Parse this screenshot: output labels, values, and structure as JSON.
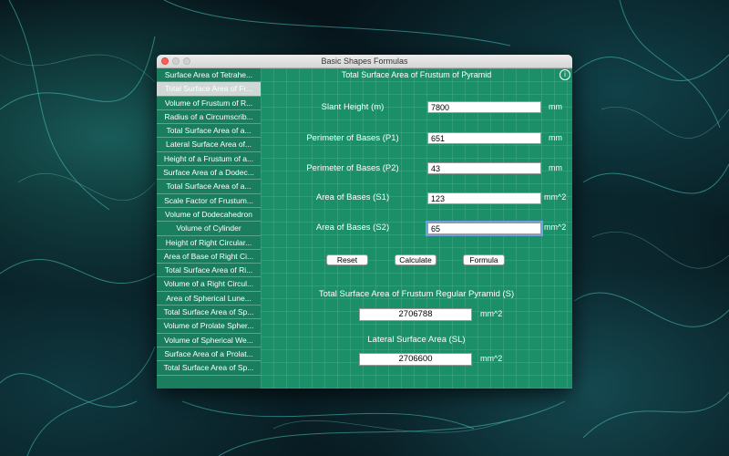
{
  "window": {
    "title": "Basic Shapes Formulas"
  },
  "sidebar": {
    "items": [
      {
        "label": "Surface Area of Tetrahe..."
      },
      {
        "label": "Total Surface Area of Fr..."
      },
      {
        "label": "Volume of Frustum of R..."
      },
      {
        "label": "Radius of a Circumscrib..."
      },
      {
        "label": "Total Surface Area of a..."
      },
      {
        "label": "Lateral Surface Area of..."
      },
      {
        "label": "Height of a Frustum of a..."
      },
      {
        "label": "Surface Area of a Dodec..."
      },
      {
        "label": "Total Surface Area of a..."
      },
      {
        "label": "Scale Factor of Frustum..."
      },
      {
        "label": "Volume of Dodecahedron"
      },
      {
        "label": "Volume of Cylinder"
      },
      {
        "label": "Height of Right Circular..."
      },
      {
        "label": "Area of Base of Right Ci..."
      },
      {
        "label": "Total Surface Area of Ri..."
      },
      {
        "label": "Volume of a Right Circul..."
      },
      {
        "label": "Area of Spherical Lune..."
      },
      {
        "label": "Total Surface Area of Sp..."
      },
      {
        "label": "Volume of Prolate Spher..."
      },
      {
        "label": "Volume of Spherical We..."
      },
      {
        "label": "Surface Area of a Prolat..."
      },
      {
        "label": "Total Surface Area of Sp..."
      }
    ]
  },
  "main": {
    "title": "Total Surface Area of Frustum of Pyramid",
    "fields": [
      {
        "label": "Slant Height (m)",
        "value": "7800",
        "unit": "mm"
      },
      {
        "label": "Perimeter of Bases (P1)",
        "value": "651",
        "unit": "mm"
      },
      {
        "label": "Perimeter of Bases (P2)",
        "value": "43",
        "unit": "mm"
      },
      {
        "label": "Area of Bases (S1)",
        "value": "123",
        "unit": "mm^2"
      },
      {
        "label": "Area of Bases (S2)",
        "value": "65",
        "unit": "mm^2"
      }
    ],
    "buttons": {
      "reset": "Reset",
      "calculate": "Calculate",
      "formula": "Formula"
    },
    "results": [
      {
        "title": "Total Surface Area of Frustum Regular Pyramid (S)",
        "value": "2706788",
        "unit": "mm^2"
      },
      {
        "title": "Lateral Surface Area (SL)",
        "value": "2706600",
        "unit": "mm^2"
      }
    ]
  },
  "colors": {
    "panel_green": "#1a8f68",
    "sidebar_green": "#1a7d5e",
    "selected": "#cfd8d4"
  }
}
